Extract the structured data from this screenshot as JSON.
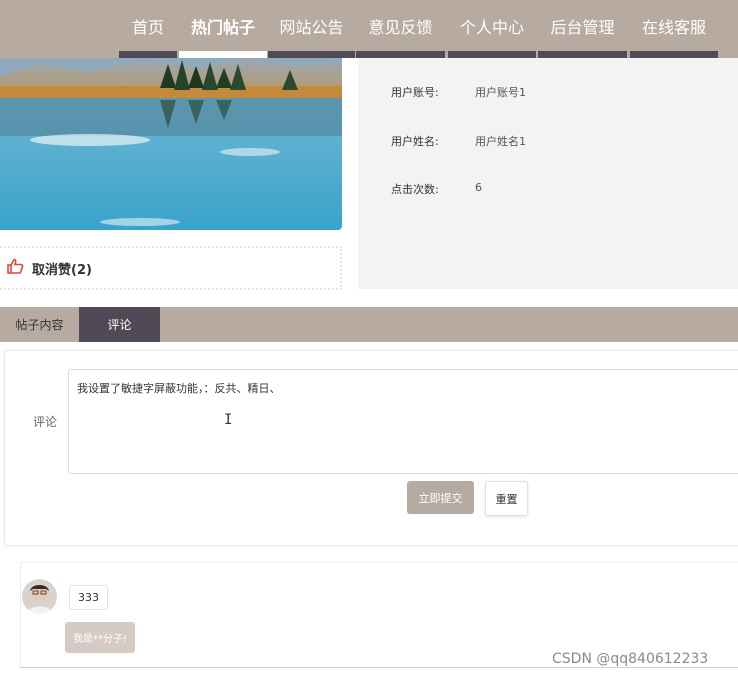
{
  "nav": {
    "items": [
      {
        "label": "首页"
      },
      {
        "label": "热门帖子"
      },
      {
        "label": "网站公告"
      },
      {
        "label": "意见反馈"
      },
      {
        "label": "个人中心"
      },
      {
        "label": "后台管理"
      },
      {
        "label": "在线客服"
      }
    ],
    "active_index": 1
  },
  "like": {
    "label": "取消赞(2)"
  },
  "info": {
    "rows": [
      {
        "label": "用户账号:",
        "value": "用户账号1"
      },
      {
        "label": "用户姓名:",
        "value": "用户姓名1"
      },
      {
        "label": "点击次数:",
        "value": "6"
      }
    ]
  },
  "tabs": [
    {
      "label": "帖子内容"
    },
    {
      "label": "评论"
    }
  ],
  "form": {
    "label": "评论",
    "value": "我设置了敏捷字屏蔽功能，：反共、精日、",
    "submit_label": "立即提交",
    "reset_label": "重置"
  },
  "comments": [
    {
      "user": "333",
      "text": "我是**分子!"
    }
  ],
  "watermark": "CSDN @qq840612233",
  "colors": {
    "nav_bg": "#b7aaa1",
    "nav_bar": "#4f4a55",
    "accent": "#b7aaa1"
  }
}
